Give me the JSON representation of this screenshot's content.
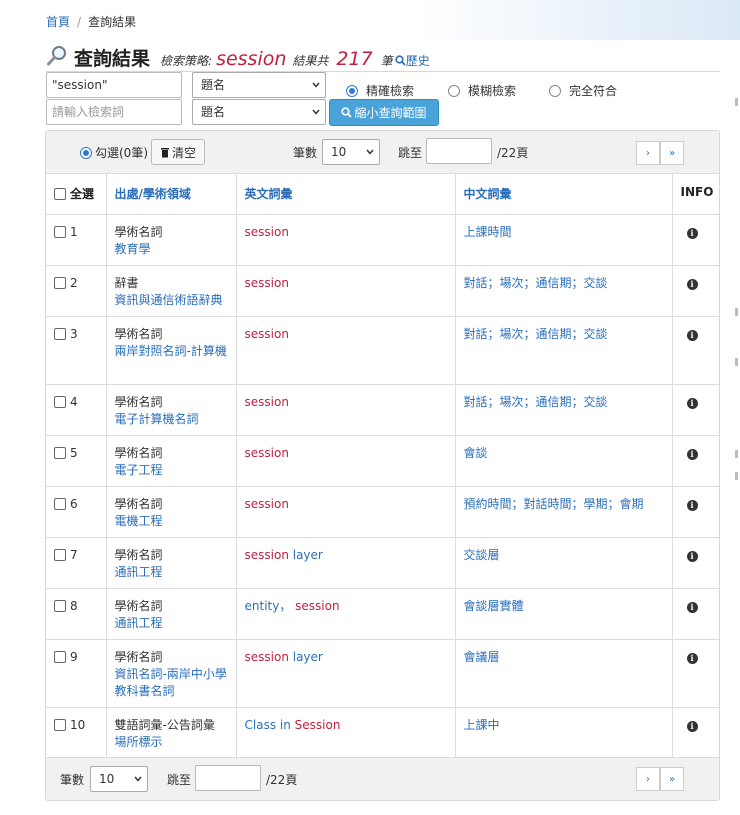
{
  "breadcrumb": {
    "home": "首頁",
    "separator": "/",
    "current": "查詢結果"
  },
  "title": {
    "text": "查詢結果",
    "strategy_label": "檢索策略:",
    "strategy_value": "session",
    "result_label": "結果共",
    "result_count": "217",
    "result_unit": "筆",
    "history": "歷史"
  },
  "search": {
    "term1_value": "\"session\"",
    "term2_placeholder": "請輸入檢索詞",
    "field1": "題名",
    "field2": "題名",
    "modes": [
      {
        "label": "精確檢索",
        "selected": true
      },
      {
        "label": "模糊檢索",
        "selected": false
      },
      {
        "label": "完全符合",
        "selected": false
      }
    ],
    "narrow_button": "縮小查詢範圍"
  },
  "toolbar": {
    "checked_label": "勾選(0筆)",
    "clear_label": "清空",
    "page_size_label": "筆數",
    "page_size": "10",
    "jump_label": "跳至",
    "total_pages": "/22頁",
    "next": "›",
    "last": "»"
  },
  "table": {
    "headers": {
      "select_all": "全選",
      "source": "出處/學術領域",
      "english": "英文詞彙",
      "chinese": "中文詞彙",
      "info": "INFO"
    },
    "rows": [
      {
        "num": "1",
        "type": "學術名詞",
        "field": "教育學",
        "en_pre": "",
        "en_hi": "session",
        "en_post": "",
        "zh": "上課時間"
      },
      {
        "num": "2",
        "type": "辭書",
        "field": "資訊與通信術語辭典",
        "en_pre": "",
        "en_hi": "session",
        "en_post": "",
        "zh": "對話；場次；通信期；交談"
      },
      {
        "num": "3",
        "type": "學術名詞",
        "field": "兩岸對照名詞-計算機",
        "en_pre": "",
        "en_hi": "session",
        "en_post": "",
        "zh": "對話；場次；通信期；交談"
      },
      {
        "num": "4",
        "type": "學術名詞",
        "field": "電子計算機名詞",
        "en_pre": "",
        "en_hi": "session",
        "en_post": "",
        "zh": "對話；場次；通信期；交談"
      },
      {
        "num": "5",
        "type": "學術名詞",
        "field": "電子工程",
        "en_pre": "",
        "en_hi": "session",
        "en_post": "",
        "zh": "會談"
      },
      {
        "num": "6",
        "type": "學術名詞",
        "field": "電機工程",
        "en_pre": "",
        "en_hi": "session",
        "en_post": "",
        "zh": "預約時間；對話時間；學期；會期"
      },
      {
        "num": "7",
        "type": "學術名詞",
        "field": "通訊工程",
        "en_pre": "",
        "en_hi": "session",
        "en_post": " layer",
        "zh": "交談層"
      },
      {
        "num": "8",
        "type": "學術名詞",
        "field": "通訊工程",
        "en_pre": "entity， ",
        "en_hi": "session",
        "en_post": "",
        "zh": "會談層實體"
      },
      {
        "num": "9",
        "type": "學術名詞",
        "field": "資訊名詞-兩岸中小學教科書名詞",
        "en_pre": "",
        "en_hi": "session",
        "en_post": " layer",
        "zh": "會議層"
      },
      {
        "num": "10",
        "type": "雙語詞彙-公告詞彙",
        "field": "場所標示",
        "en_pre": "Class in ",
        "en_hi": "Session",
        "en_post": "",
        "zh": "上課中"
      }
    ]
  },
  "footer": {
    "page_size_label": "筆數",
    "page_size": "10",
    "jump_label": "跳至",
    "total_pages": "/22頁",
    "next": "›",
    "last": "»"
  },
  "colors": {
    "accent": "#2a6ebb",
    "highlight": "#c0203f",
    "button": "#4aa3d8"
  }
}
